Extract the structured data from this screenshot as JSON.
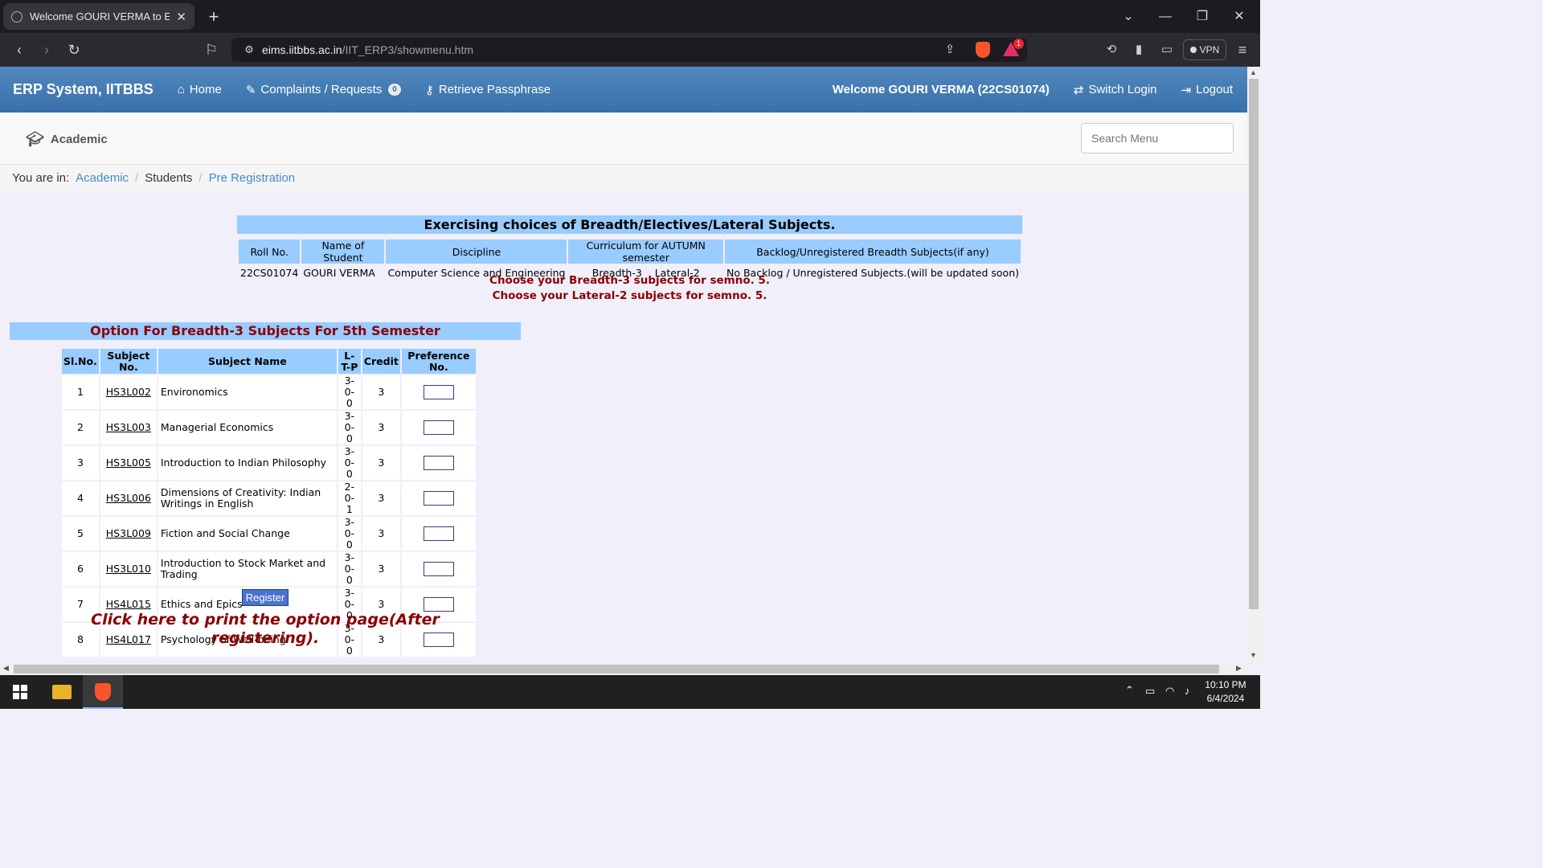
{
  "browser": {
    "tab_title": "Welcome GOURI VERMA to ERP",
    "url_host": "eims.iitbbs.ac.in",
    "url_path": "/IIT_ERP3/showmenu.htm",
    "vpn_label": "VPN",
    "alert_count": "1"
  },
  "navbar": {
    "brand": "ERP System, IITBBS",
    "home": "Home",
    "complaints": "Complaints / Requests",
    "complaints_count": "0",
    "retrieve": "Retrieve Passphrase",
    "welcome": "Welcome GOURI VERMA (22CS01074)",
    "switch_login": "Switch Login",
    "logout": "Logout"
  },
  "subheader": {
    "academic": "Academic",
    "search_placeholder": "Search Menu"
  },
  "breadcrumb": {
    "prefix": "You are in:",
    "items": [
      "Academic",
      "Students",
      "Pre Registration"
    ]
  },
  "page": {
    "heading": "Exercising choices of Breadth/Electives/Lateral Subjects.",
    "info_headers": [
      "Roll No.",
      "Name of Student",
      "Discipline",
      "Curriculum for AUTUMN semester",
      "Backlog/Unregistered Breadth Subjects(if any)"
    ],
    "info_row": {
      "roll": "22CS01074",
      "name": "GOURI VERMA",
      "discipline": "Computer Science and Engineering",
      "curriculum_1": "Breadth-3",
      "curriculum_2": "Lateral-2",
      "backlog": "No Backlog / Unregistered Subjects.(will be updated soon)"
    },
    "msg_breadth": "Choose your Breadth-3 subjects for semno. 5.",
    "msg_lateral": "Choose your Lateral-2 subjects for semno. 5.",
    "option_title": "Option For Breadth-3 Subjects For 5th Semester",
    "table_headers": {
      "sl": "Sl.No.",
      "subno_1": "Subject",
      "subno_2": "No.",
      "name": "Subject Name",
      "ltp_1": "L-",
      "ltp_2": "T-P",
      "credit": "Credit",
      "pref_1": "Preference",
      "pref_2": "No."
    },
    "subjects": [
      {
        "sl": "1",
        "code": "HS3L002",
        "name_1": "Environomics",
        "name_2": "",
        "ltp_1": "3-0-",
        "ltp_2": "0",
        "credit": "3"
      },
      {
        "sl": "2",
        "code": "HS3L003",
        "name_1": "Managerial Economics",
        "name_2": "",
        "ltp_1": "3-0-",
        "ltp_2": "0",
        "credit": "3"
      },
      {
        "sl": "3",
        "code": "HS3L005",
        "name_1": "Introduction to Indian Philosophy",
        "name_2": "",
        "ltp_1": "3-0-",
        "ltp_2": "0",
        "credit": "3"
      },
      {
        "sl": "4",
        "code": "HS3L006",
        "name_1": "Dimensions of Creativity: Indian",
        "name_2": "Writings in English",
        "ltp_1": "2-0-",
        "ltp_2": "1",
        "credit": "3"
      },
      {
        "sl": "5",
        "code": "HS3L009",
        "name_1": "Fiction and Social Change",
        "name_2": "",
        "ltp_1": "3-0-",
        "ltp_2": "0",
        "credit": "3"
      },
      {
        "sl": "6",
        "code": "HS3L010",
        "name_1": "Introduction to Stock Market and",
        "name_2": "Trading",
        "ltp_1": "3-0-",
        "ltp_2": "0",
        "credit": "3"
      },
      {
        "sl": "7",
        "code": "HS4L015",
        "name_1": "Ethics and Epics",
        "name_2": "",
        "ltp_1": "3-0-",
        "ltp_2": "0",
        "credit": "3"
      },
      {
        "sl": "8",
        "code": "HS4L017",
        "name_1": "Psychology of Well-being",
        "name_2": "",
        "ltp_1": "3-0-",
        "ltp_2": "0",
        "credit": "3"
      }
    ],
    "register_label": "Register",
    "print_link": "Click here to print the option page(After registering)."
  },
  "taskbar": {
    "time": "10:10 PM",
    "date": "6/4/2024"
  }
}
